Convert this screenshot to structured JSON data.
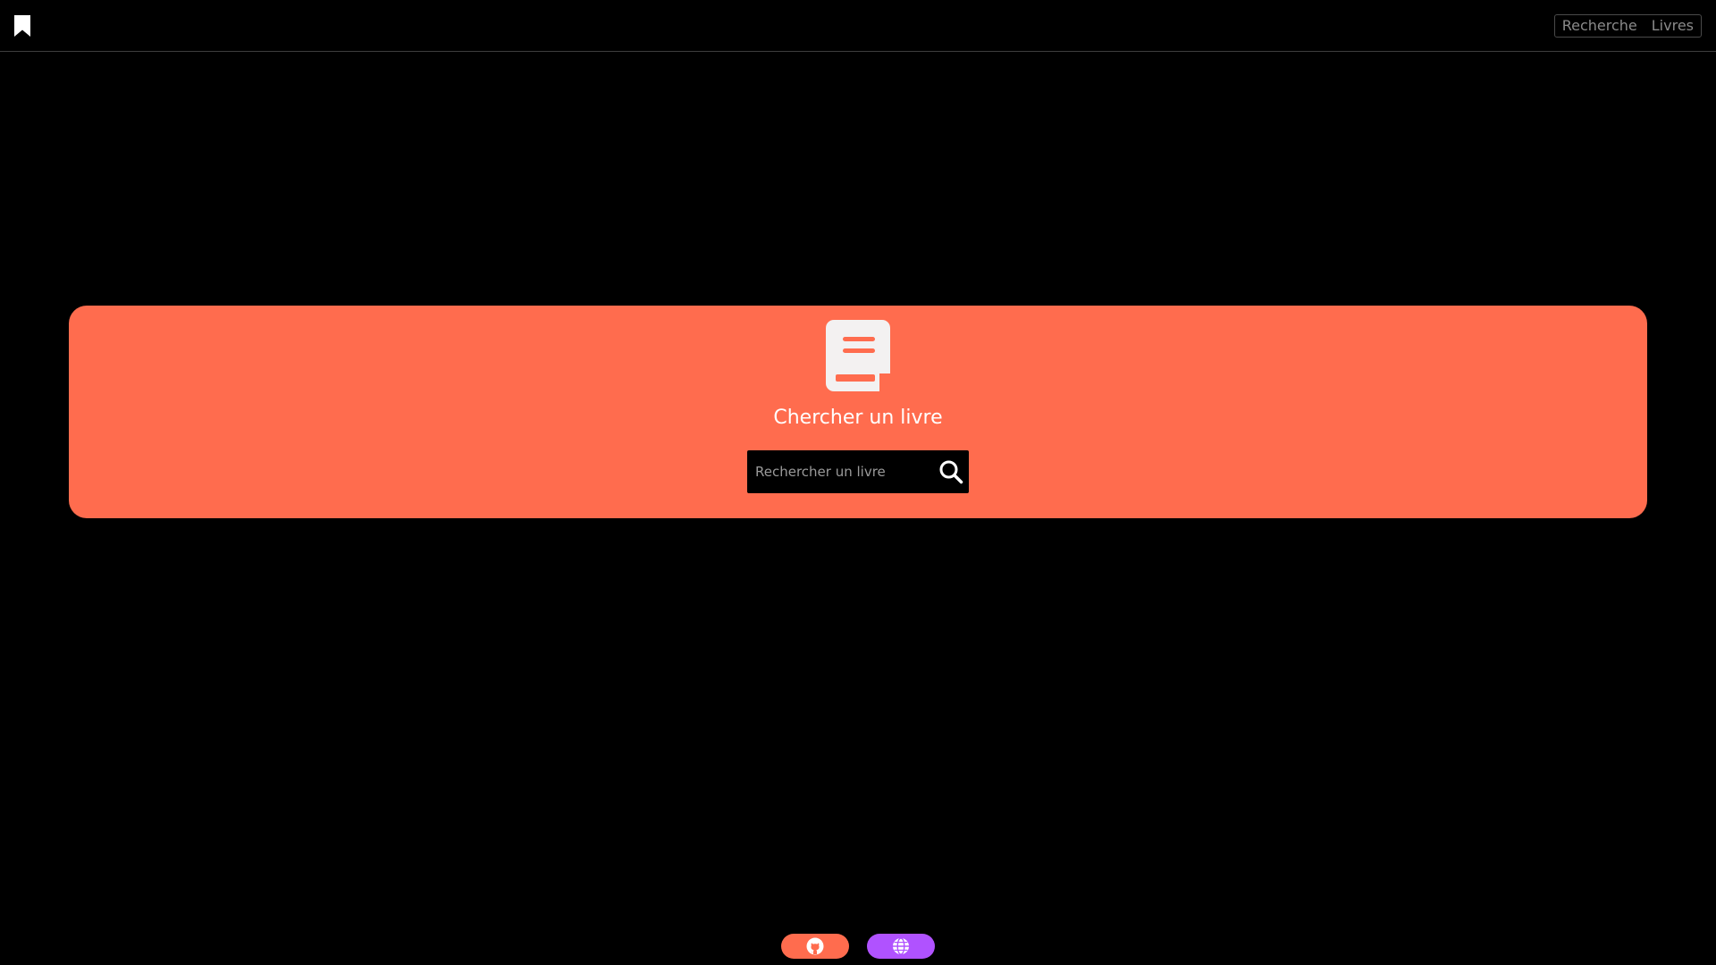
{
  "header": {
    "logo_icon": "bookmark-icon",
    "nav": [
      {
        "label": "Recherche"
      },
      {
        "label": "Livres"
      }
    ]
  },
  "hero": {
    "icon": "book-icon",
    "title": "Chercher un livre",
    "search": {
      "placeholder": "Rechercher un livre",
      "value": "",
      "button_icon": "search-icon"
    }
  },
  "footer": {
    "buttons": [
      {
        "icon": "github-icon",
        "color": "#ff6c4e"
      },
      {
        "icon": "globe-icon",
        "color": "#b052ff"
      }
    ]
  },
  "colors": {
    "background": "#000000",
    "accent": "#ff6c4e",
    "secondary": "#b052ff",
    "text": "#ffffff"
  }
}
